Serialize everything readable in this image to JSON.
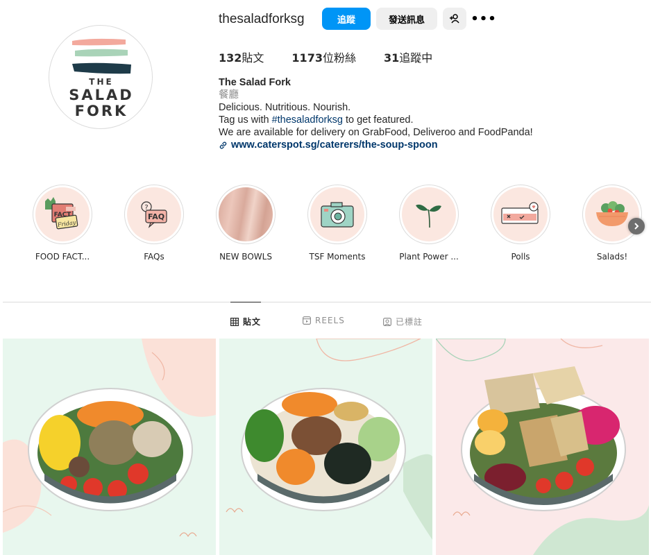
{
  "profile": {
    "username": "thesaladforksg",
    "avatar_lines": [
      "THE",
      "SALAD",
      "FORK"
    ],
    "buttons": {
      "follow": "追蹤",
      "message": "發送訊息",
      "add_user_icon": "person-add-icon",
      "more_icon": "more-horizontal-icon",
      "more_glyph": "•••"
    },
    "stats": {
      "posts_count": "132",
      "posts_label": "貼文",
      "followers_count": "1173",
      "followers_label": "位粉絲",
      "following_count": "31",
      "following_label": "追蹤中"
    },
    "bio": {
      "name": "The Salad Fork",
      "category": "餐廳",
      "line1": "Delicious. Nutritious. Nourish.",
      "line2_before": "Tag us with ",
      "line2_hashtag": "#thesaladforksg",
      "line2_after": " to get featured.",
      "line3": "We are available for delivery on GrabFood, Deliveroo and FoodPanda!",
      "link": "www.caterspot.sg/caterers/the-soup-spoon"
    }
  },
  "highlights": [
    {
      "label": "FOOD FACT...",
      "icon": "fact-friday-icon"
    },
    {
      "label": "FAQs",
      "icon": "faq-icon"
    },
    {
      "label": "NEW BOWLS",
      "icon": "pink-texture-icon"
    },
    {
      "label": "TSF Moments",
      "icon": "camera-icon"
    },
    {
      "label": "Plant Power ...",
      "icon": "sprout-icon"
    },
    {
      "label": "Polls",
      "icon": "poll-icon"
    },
    {
      "label": "Salads!",
      "icon": "salad-bowl-icon"
    }
  ],
  "highlight_art": {
    "fact_top": "FACT",
    "fact_bottom": "Friday",
    "faq": "FAQ"
  },
  "tabs": [
    {
      "label": "貼文",
      "icon": "grid-icon",
      "active": true
    },
    {
      "label": "REELS",
      "icon": "reels-icon",
      "active": false
    },
    {
      "label": "已標註",
      "icon": "tagged-icon",
      "active": false
    }
  ],
  "colors": {
    "accent": "#0095f6",
    "secondary_button": "#efefef",
    "link": "#00376b",
    "highlight_bg": "#fbe7e0",
    "post_bg_mint": "#e8f7ee",
    "post_bg_pink": "#fbe9e9"
  },
  "posts": [
    {
      "icon": "salad-bowl-image"
    },
    {
      "icon": "beef-bowl-image"
    },
    {
      "icon": "chicken-bowl-image"
    }
  ]
}
